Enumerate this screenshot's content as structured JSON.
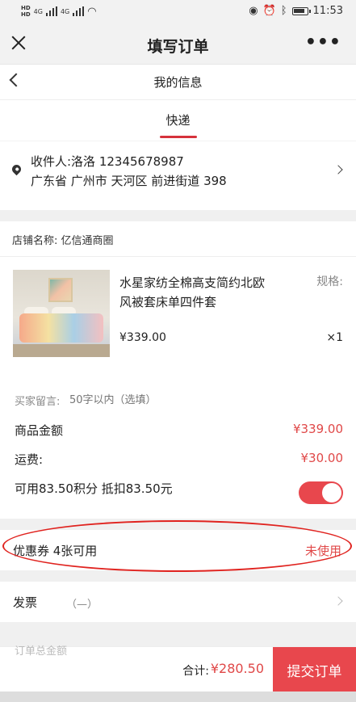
{
  "status_bar": {
    "left_hd": [
      "HD",
      "HD"
    ],
    "net_left": "4G",
    "net_right": "4G",
    "time": "11:53"
  },
  "nav": {
    "title": "填写订单",
    "more": "•••"
  },
  "info": {
    "title": "我的信息",
    "tab": "快递"
  },
  "address": {
    "line1": "收件人:洛洛 12345678987",
    "line2": "广东省 广州市 天河区 前进街道 398"
  },
  "store": {
    "label": "店铺名称: 亿信通商圈"
  },
  "product": {
    "name": "水星家纺全棉高支简约北欧风被套床单四件套",
    "spec_label": "规格:",
    "price": "¥339.00",
    "qty": "×1"
  },
  "message": {
    "label": "买家留言:",
    "placeholder": "50字以内（选填）"
  },
  "summary": {
    "goods_label": "商品金额",
    "goods_value": "¥339.00",
    "shipping_label": "运费:",
    "shipping_value": "¥30.00",
    "points_label": "可用83.50积分 抵扣83.50元",
    "points_enabled": true
  },
  "coupon": {
    "label": "优惠券 4张可用",
    "status": "未使用"
  },
  "invoice": {
    "label": "发票",
    "value": "（—）"
  },
  "footer": {
    "peek_text": "订单总金额",
    "total_label": "合计:",
    "total_value": "¥280.50",
    "submit_label": "提交订单"
  },
  "colors": {
    "accent": "#e8474d",
    "price_red": "#e04848",
    "annotation_red": "#e0231f"
  }
}
